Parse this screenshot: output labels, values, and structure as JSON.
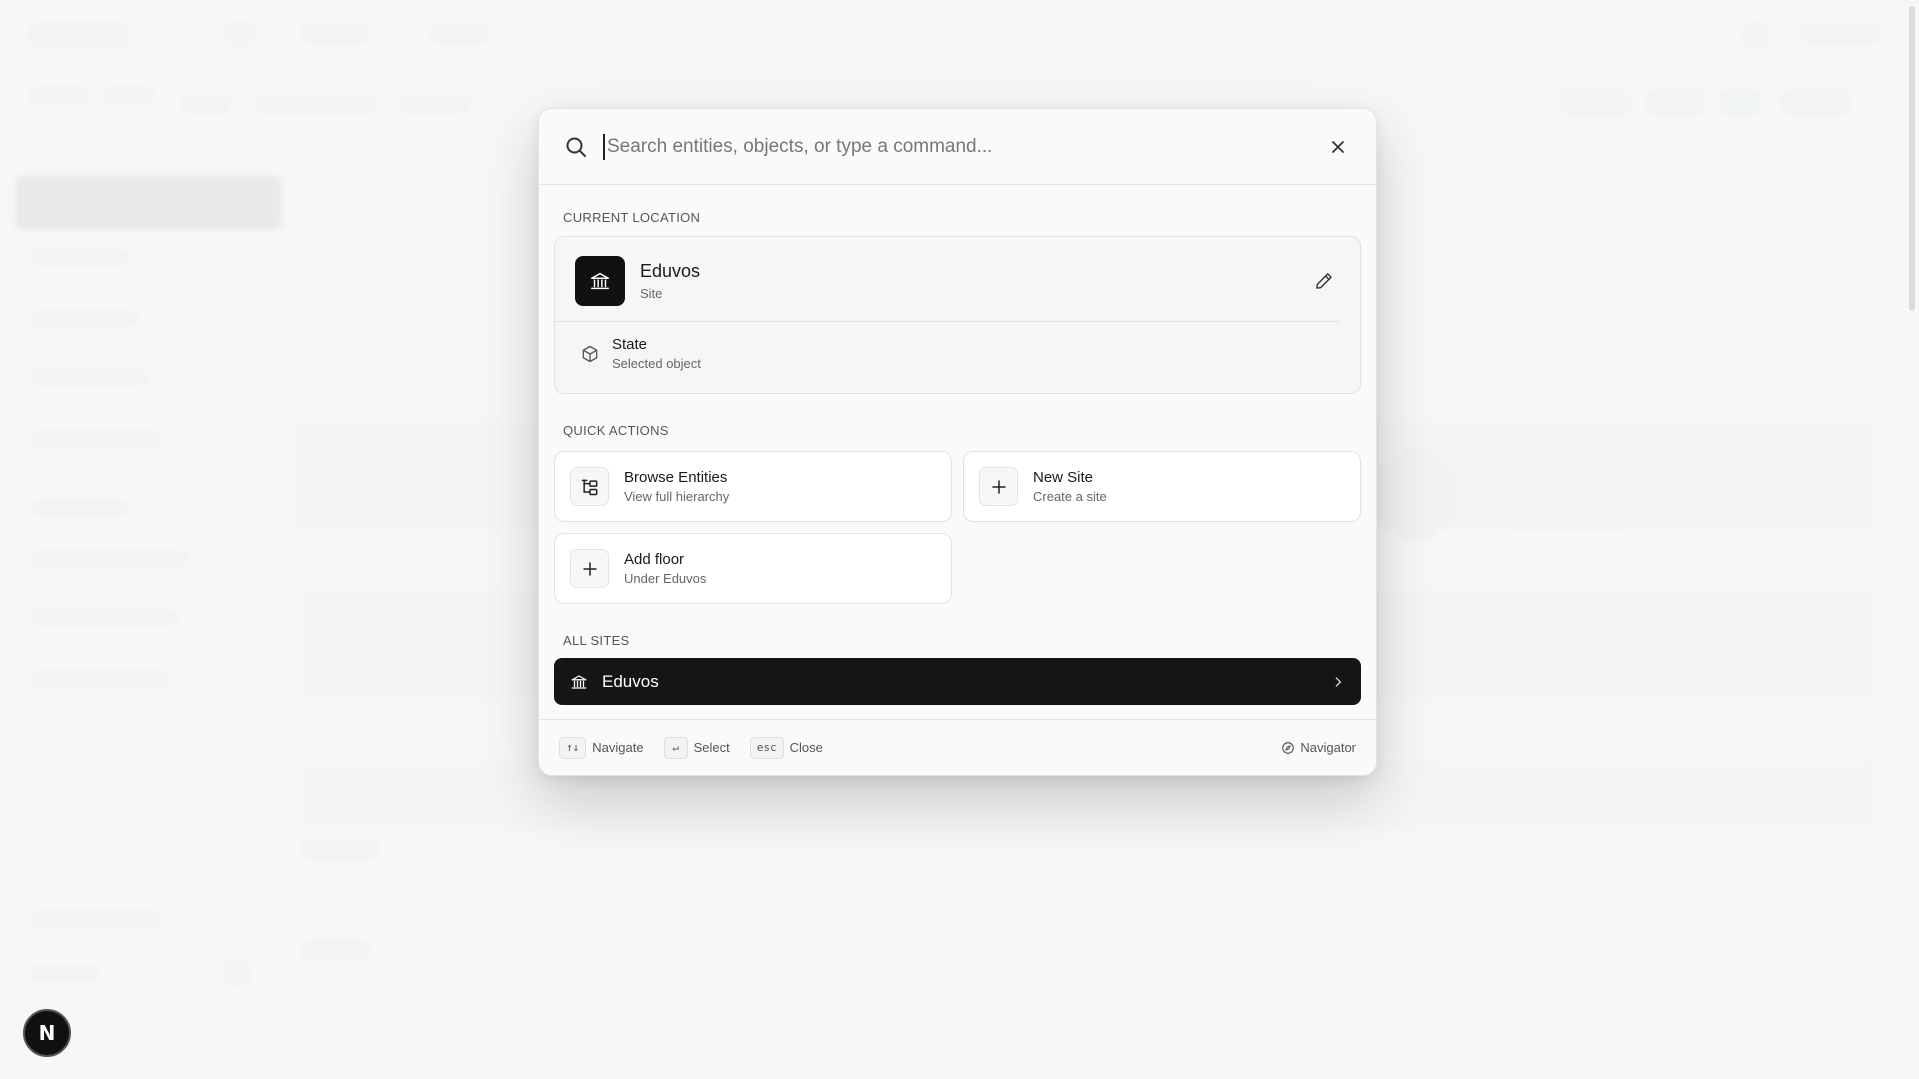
{
  "search": {
    "placeholder": "Search entities, objects, or type a command..."
  },
  "current_location": {
    "heading": "CURRENT LOCATION",
    "site_name": "Eduvos",
    "site_type": "Site",
    "object_name": "State",
    "object_type": "Selected object"
  },
  "quick_actions": {
    "heading": "QUICK ACTIONS",
    "items": [
      {
        "title": "Browse Entities",
        "subtitle": "View full hierarchy",
        "icon": "hierarchy-icon"
      },
      {
        "title": "New Site",
        "subtitle": "Create a site",
        "icon": "plus-icon"
      },
      {
        "title": "Add floor",
        "subtitle": "Under Eduvos",
        "icon": "plus-icon"
      }
    ]
  },
  "all_sites": {
    "heading": "ALL SITES",
    "items": [
      {
        "label": "Eduvos",
        "icon": "building-icon"
      }
    ]
  },
  "footer": {
    "navigate_key": "↑↓",
    "navigate_label": "Navigate",
    "select_key": "↵",
    "select_label": "Select",
    "close_key": "esc",
    "close_label": "Close",
    "navigator_label": "Navigator"
  },
  "badge": {
    "letter": "N"
  },
  "colors": {
    "accent_dark": "#151515",
    "panel_bg": "#fafafa"
  }
}
